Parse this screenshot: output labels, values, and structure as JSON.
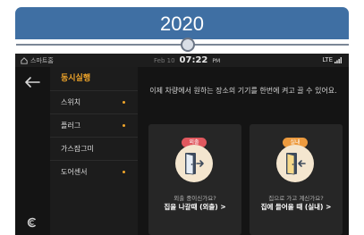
{
  "banner": {
    "year": "2020"
  },
  "statusbar": {
    "app_name": "스마트홈",
    "date": "Feb 10",
    "time": "07:22",
    "ampm": "PM",
    "network": "LTE"
  },
  "menu": {
    "items": [
      {
        "label": "동시실행",
        "active": true,
        "dot": false
      },
      {
        "label": "스위치",
        "active": false,
        "dot": true
      },
      {
        "label": "플러그",
        "active": false,
        "dot": true
      },
      {
        "label": "가스잠그미",
        "active": false,
        "dot": false
      },
      {
        "label": "도어센서",
        "active": false,
        "dot": true
      }
    ]
  },
  "content": {
    "instruction": "이제 차량에서 원하는 장소의 기기를 한번에 켜고 끌 수 있어요.",
    "cards": [
      {
        "tag": "외출",
        "question": "외출 중이신가요?",
        "action": "집을 나갈때 (외출) >"
      },
      {
        "tag": "실내",
        "question": "집으로 가고 계신가요?",
        "action": "집에 들어올 때 (실내) >"
      }
    ]
  },
  "colors": {
    "banner": "#3f6fa3",
    "accent": "#f0a52a",
    "tag_outing": "#e0585e",
    "tag_home": "#ec9a3e",
    "screen_bg": "#141414",
    "menu_bg": "#1c1c1c",
    "card_bg": "#262626"
  },
  "icons": {
    "app": "house-icon",
    "back": "back-arrow-icon",
    "brand": "brand-logo-icon",
    "outing": "door-exit-icon",
    "home": "door-enter-icon",
    "signal": "signal-bars-icon"
  }
}
